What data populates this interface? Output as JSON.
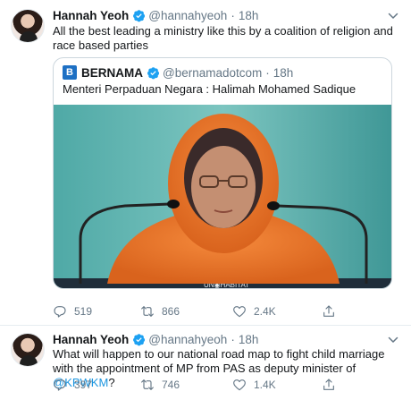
{
  "tweets": [
    {
      "author": "Hannah Yeoh",
      "handle": "@hannahyeoh",
      "separator": "·",
      "time": "18h",
      "text": "All the best leading a ministry like this by a coalition of religion and race based parties",
      "quote": {
        "avatar_letter": "B",
        "author": "BERNAMA",
        "handle": "@bernamadotcom",
        "separator": "·",
        "time": "18h",
        "text": "Menteri Perpaduan Negara : Halimah Mohamed Sadique",
        "image_banner_text": "UN◉HABITAT"
      },
      "replies": "519",
      "retweets": "866",
      "likes": "2.4K"
    },
    {
      "author": "Hannah Yeoh",
      "handle": "@hannahyeoh",
      "separator": "·",
      "time": "18h",
      "text_before": "What will happen to our national road map to fight child marriage with the appointment of MP from PAS as deputy minister of ",
      "mention": "@KPWKM",
      "text_after": "?",
      "replies": "397",
      "retweets": "746",
      "likes": "1.4K"
    }
  ],
  "icons": {
    "verified": "verified-badge-icon",
    "caret": "chevron-down-icon",
    "reply": "reply-icon",
    "retweet": "retweet-icon",
    "like": "heart-icon",
    "share": "share-icon"
  },
  "colors": {
    "accent": "#1da1f2",
    "mention": "#1b95e0",
    "secondary_text": "#657786",
    "border": "#e6ecf0",
    "bernama_blue": "#1d70c4"
  }
}
